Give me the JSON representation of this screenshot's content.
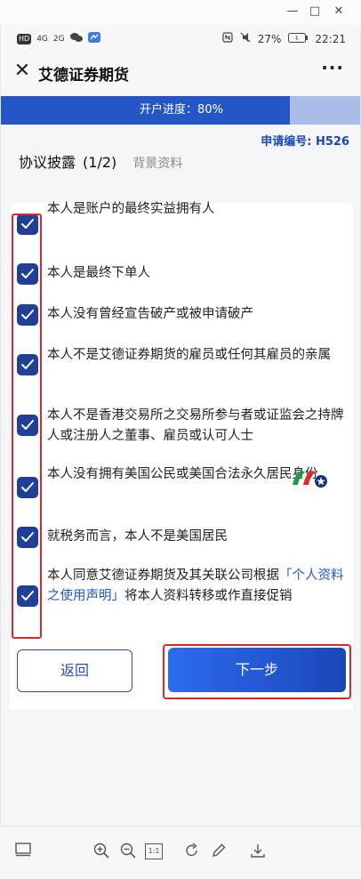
{
  "window": {
    "minimize_icon": "—",
    "maximize_icon": "□",
    "close_icon": "✕"
  },
  "status_bar": {
    "left_icons": [
      "HD",
      "4G",
      "2G"
    ],
    "battery": "27%",
    "time": "22:21"
  },
  "nav": {
    "close_icon": "✕",
    "title": "艾德证券期货",
    "more_icon": "···"
  },
  "progress": {
    "label": "开户进度：80%",
    "value": 0.8,
    "fill_color": "#2456c6",
    "track_color": "#a8bde8"
  },
  "application_no": "申请编号: H526",
  "tabs": {
    "active": "协议披露",
    "count": "(1/2)",
    "other": "背景资料"
  },
  "declarations": [
    {
      "text": "本人是账户的最终实益拥有人",
      "checked": true
    },
    {
      "text": "本人是最终下单人",
      "checked": true
    },
    {
      "text": "本人没有曾经宣告破产或被申请破产",
      "checked": true
    },
    {
      "text": "本人不是艾德证券期货的雇员或任何其雇员的亲属",
      "checked": true
    },
    {
      "text": "本人不是香港交易所之交易所参与者或证监会之持牌人或注册人之董事、雇员或认可人士",
      "checked": true
    },
    {
      "text": "本人没有拥有美国公民或美国合法永久居民身份",
      "checked": true
    },
    {
      "text": "就税务而言，本人不是美国居民",
      "checked": true
    },
    {
      "text_before": "本人同意艾德证券期货及其关联公司根据",
      "link": "「个人资料之使用声明」",
      "text_after": "将本人资料转移或作直接促销",
      "checked": true
    }
  ],
  "buttons": {
    "back": "返回",
    "next": "下一步"
  },
  "colors": {
    "accent": "#1f3f98",
    "highlight_box": "#e0262a"
  },
  "toolbar": {
    "icons": [
      "panel-icon",
      "zoom-in-icon",
      "zoom-out-icon",
      "actual-size-icon",
      "rotate-icon",
      "edit-icon",
      "download-icon"
    ],
    "actual_size_label": "1:1"
  }
}
